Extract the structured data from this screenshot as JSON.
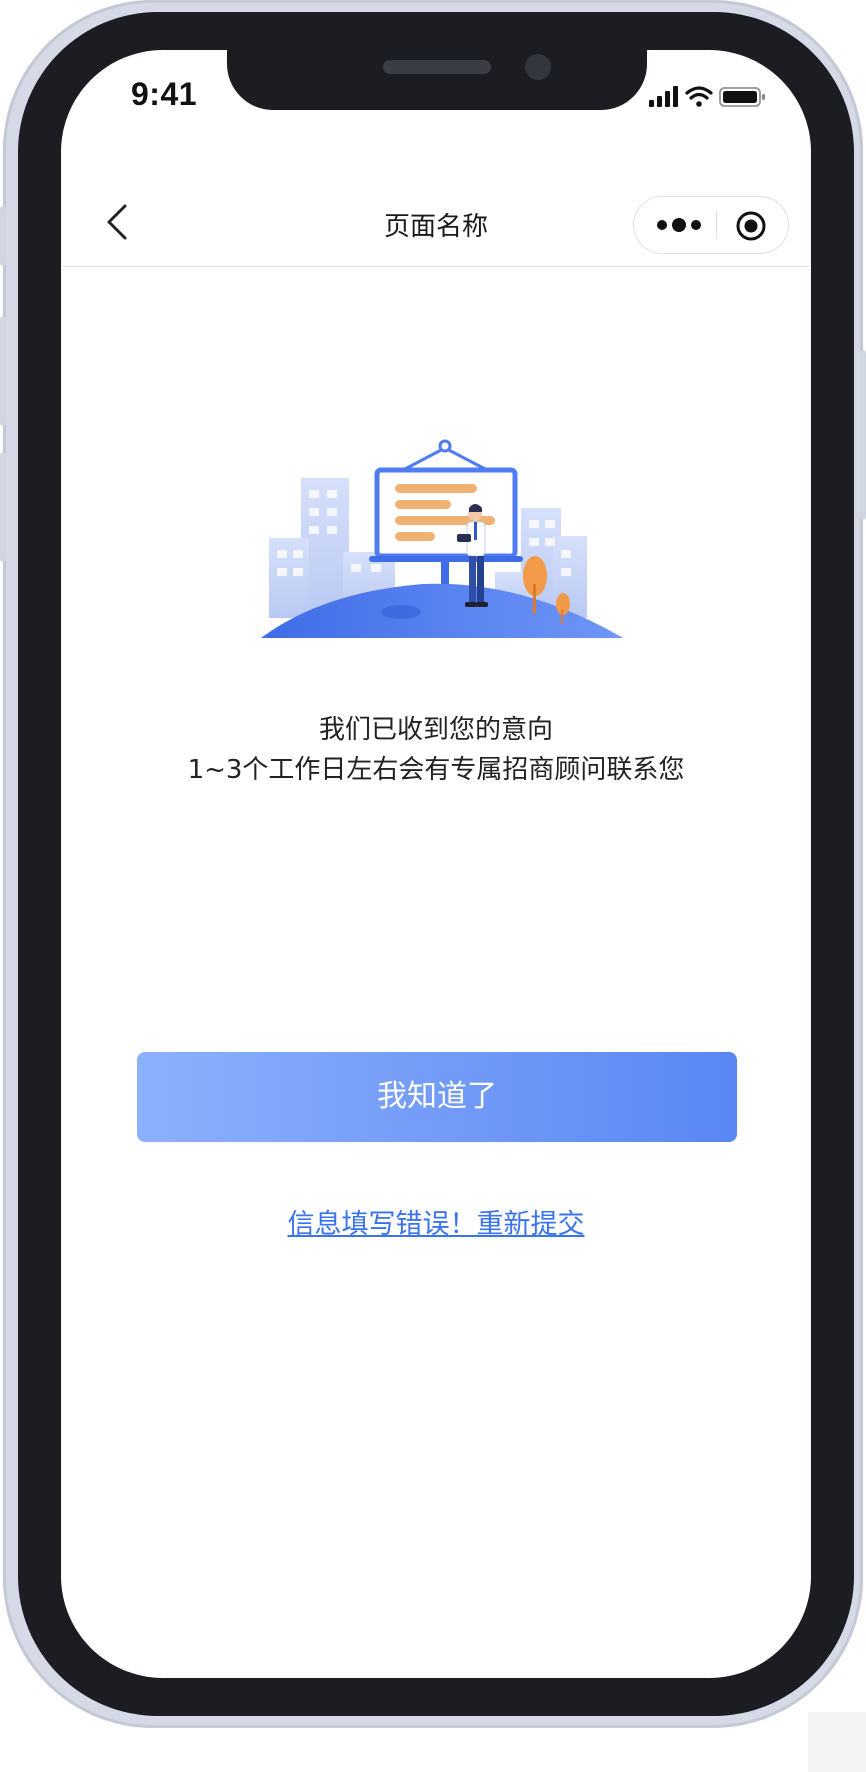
{
  "status_bar": {
    "time": "9:41",
    "icons": [
      "cellular-signal-icon",
      "wifi-icon",
      "battery-icon"
    ]
  },
  "nav": {
    "title": "页面名称",
    "back_icon": "chevron-left-icon",
    "capsule_icons": [
      "more-dots-icon",
      "close-target-icon"
    ]
  },
  "illustration": {
    "description_icon": "office-presentation-illustration",
    "colors": {
      "blue": "#4f7cf0",
      "light_blue": "#cdd8f7",
      "orange": "#f0a05a",
      "board_line": "#f2b87a"
    }
  },
  "message": {
    "line1": "我们已收到您的意向",
    "line2": "1~3个工作日左右会有专属招商顾问联系您"
  },
  "actions": {
    "confirm_label": "我知道了",
    "resubmit_label": "信息填写错误！重新提交"
  },
  "colors": {
    "button_gradient_start": "#8cb1fb",
    "button_gradient_end": "#5a86f4",
    "link": "#3a73f0",
    "phone_frame": "#d5dae6",
    "phone_band": "#1c1d22"
  }
}
